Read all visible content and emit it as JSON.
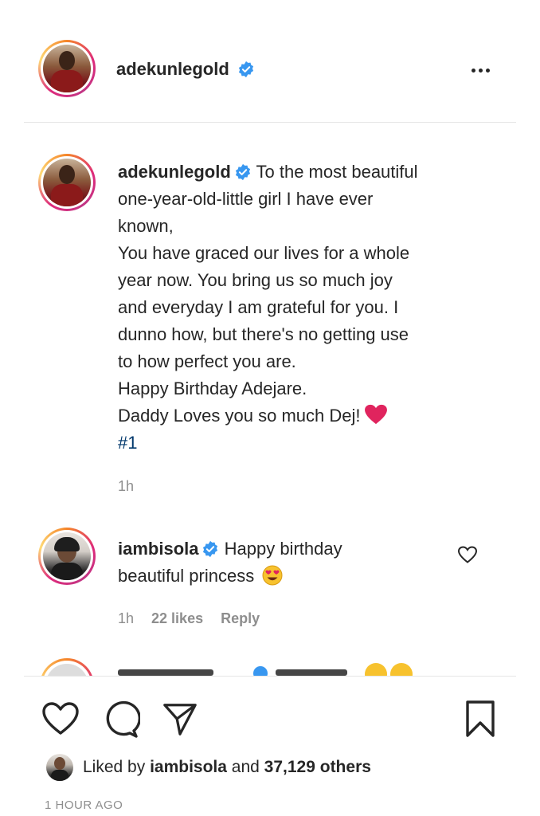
{
  "post": {
    "author": "adekunlegold",
    "verified": true,
    "more_icon": "more-dots-icon"
  },
  "caption": {
    "author": "adekunlegold",
    "lines": [
      "To the most beautiful",
      "one-year-old-little girl I have ever",
      "known,",
      "You have graced our lives for a whole",
      "year now. You bring us so much joy",
      "and everyday I am grateful for you. I",
      "dunno how, but there's no getting use",
      "to how perfect you are.",
      "Happy Birthday Adejare.",
      "Daddy Loves you so much Dej!"
    ],
    "hashtag": "#1",
    "time": "1h"
  },
  "comment": {
    "author": "iambisola",
    "text_line1": "Happy birthday",
    "text_line2": "beautiful princess",
    "time": "1h",
    "likes": "22 likes",
    "reply": "Reply"
  },
  "liked_by": {
    "prefix": "Liked by",
    "user": "iambisola",
    "middle": "and",
    "count": "37,129 others"
  },
  "post_time": "1 HOUR AGO",
  "colors": {
    "text": "#262626",
    "muted": "#8e8e8e",
    "verified": "#3897f0",
    "hashtag": "#00376b",
    "heart": "#e0245e"
  }
}
